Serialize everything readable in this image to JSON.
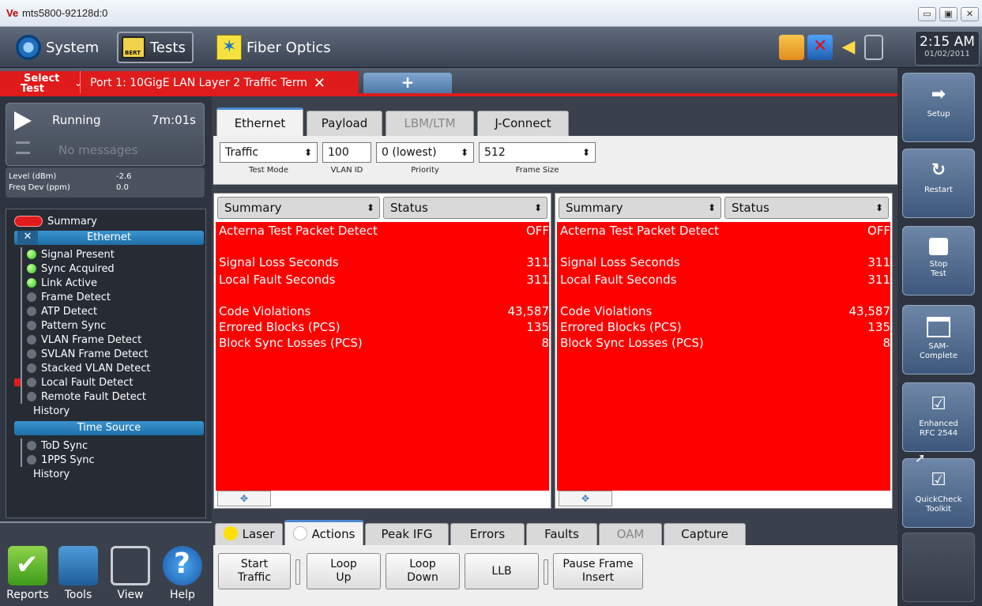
{
  "window": {
    "logo": "Ve",
    "title": "mts5800-92128d:0",
    "min": "▭",
    "max": "▣",
    "close": "✕"
  },
  "topbar": {
    "system_label": "System",
    "tests_label": "Tests",
    "fiber_label": "Fiber Optics",
    "clock_time": "2:15 AM",
    "clock_date": "01/02/2011"
  },
  "testtabs": {
    "select_l1": "Select",
    "select_l2": "Test",
    "port_label": "Port 1: 10GigE LAN Layer 2 Traffic Term",
    "add_label": "+"
  },
  "left": {
    "state": "Running",
    "elapsed": "7m:01s",
    "messages": "No messages",
    "level_label": "Level (dBm)",
    "level_value": "-2.6",
    "freq_label": "Freq Dev (ppm)",
    "freq_value": "0.0",
    "summary": "Summary",
    "ethernet_header": "Ethernet",
    "ethernet_items": [
      {
        "label": "Signal Present",
        "led": "green"
      },
      {
        "label": "Sync Acquired",
        "led": "green"
      },
      {
        "label": "Link Active",
        "led": "green"
      },
      {
        "label": "Frame Detect",
        "led": "gray"
      },
      {
        "label": "ATP Detect",
        "led": "gray"
      },
      {
        "label": "Pattern Sync",
        "led": "gray"
      },
      {
        "label": "VLAN Frame Detect",
        "led": "gray"
      },
      {
        "label": "SVLAN Frame Detect",
        "led": "gray"
      },
      {
        "label": "Stacked VLAN Detect",
        "led": "gray"
      },
      {
        "label": "Local Fault Detect",
        "led": "gray"
      },
      {
        "label": "Remote Fault Detect",
        "led": "gray"
      }
    ],
    "ethernet_history": "History",
    "timesource_header": "Time Source",
    "timesource_items": [
      {
        "label": "ToD Sync",
        "led": "gray"
      },
      {
        "label": "1PPS Sync",
        "led": "gray"
      }
    ],
    "timesource_history": "History",
    "bottom": {
      "reports": "Reports",
      "tools": "Tools",
      "view": "View",
      "help": "Help"
    }
  },
  "center": {
    "tabs": [
      {
        "label": "Ethernet",
        "state": "active"
      },
      {
        "label": "Payload",
        "state": "normal"
      },
      {
        "label": "LBM/LTM",
        "state": "dim"
      },
      {
        "label": "J-Connect",
        "state": "normal"
      }
    ],
    "params": {
      "test_mode": {
        "value": "Traffic",
        "label": "Test Mode"
      },
      "vlan_id": {
        "value": "100",
        "label": "VLAN ID"
      },
      "priority": {
        "value": "0 (lowest)",
        "label": "Priority"
      },
      "frame_size": {
        "value": "512",
        "label": "Frame Size"
      }
    },
    "panes": [
      {
        "category": "Summary",
        "view": "Status",
        "rows": [
          {
            "key": "Acterna Test Packet Detect",
            "value": "OFF"
          },
          {
            "key": "Signal Loss Seconds",
            "value": "311"
          },
          {
            "key": "Local Fault Seconds",
            "value": "311"
          },
          {
            "key": "Code Violations",
            "value": "43,587"
          },
          {
            "key": "Errored Blocks (PCS)",
            "value": "135"
          },
          {
            "key": "Block Sync Losses (PCS)",
            "value": "8"
          }
        ]
      },
      {
        "category": "Summary",
        "view": "Status",
        "rows": [
          {
            "key": "Acterna Test Packet Detect",
            "value": "OFF"
          },
          {
            "key": "Signal Loss Seconds",
            "value": "311"
          },
          {
            "key": "Local Fault Seconds",
            "value": "311"
          },
          {
            "key": "Code Violations",
            "value": "43,587"
          },
          {
            "key": "Errored Blocks (PCS)",
            "value": "135"
          },
          {
            "key": "Block Sync Losses (PCS)",
            "value": "8"
          }
        ]
      }
    ],
    "pane_expand": "✥",
    "bottom_tabs": [
      {
        "label": "Laser",
        "state": "normal",
        "led": "#ffe000"
      },
      {
        "label": "Actions",
        "state": "active",
        "led": "#ffffff"
      },
      {
        "label": "Peak IFG",
        "state": "normal"
      },
      {
        "label": "Errors",
        "state": "normal"
      },
      {
        "label": "Faults",
        "state": "normal"
      },
      {
        "label": "OAM",
        "state": "dim"
      },
      {
        "label": "Capture",
        "state": "normal"
      }
    ],
    "actions": {
      "start_traffic": "Start\nTraffic",
      "loop_up": "Loop\nUp",
      "loop_down": "Loop\nDown",
      "llb": "LLB",
      "pause_frame": "Pause Frame\nInsert"
    }
  },
  "right": {
    "setup": "Setup",
    "restart": "Restart",
    "stop_test": "Stop\nTest",
    "sam_complete": "SAM-\nComplete",
    "enhanced_rfc": "Enhanced\nRFC 2544",
    "quickcheck": "QuickCheck\nToolkit"
  },
  "colors": {
    "alarm_red": "#fe0000",
    "tab_red": "#e01b1b",
    "led_green": "#28c415",
    "accent_blue": "#1e6ea6"
  }
}
